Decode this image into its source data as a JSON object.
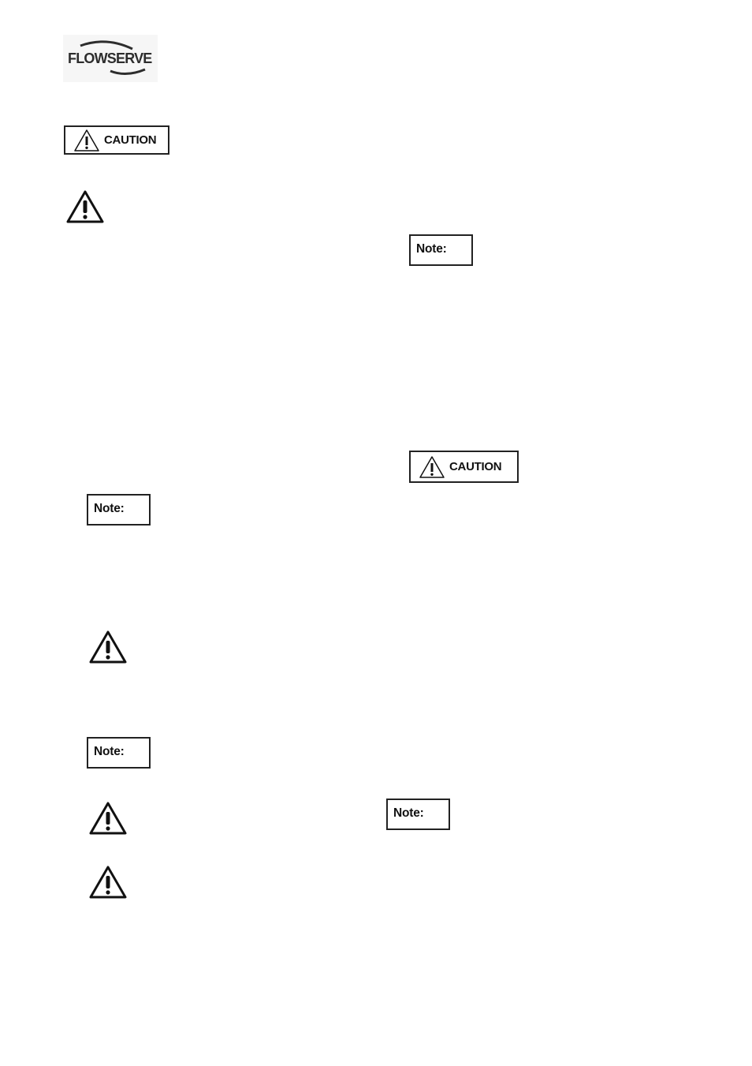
{
  "header": {
    "logo": {
      "text": "FLOWSERVE",
      "registered_mark": "®",
      "icon": "flowserve-logo"
    }
  },
  "notices": {
    "caution_label": "CAUTION",
    "note_label": "Note:",
    "caution_icon": "warning-triangle-icon",
    "hazard_icon": "warning-triangle-icon"
  },
  "left_column": {
    "items": [
      "caution-box",
      "hazard-symbol",
      "note-box",
      "hazard-symbol",
      "note-box",
      "hazard-symbol",
      "hazard-symbol"
    ]
  },
  "right_column": {
    "items": [
      "note-box",
      "caution-box",
      "note-box"
    ]
  }
}
